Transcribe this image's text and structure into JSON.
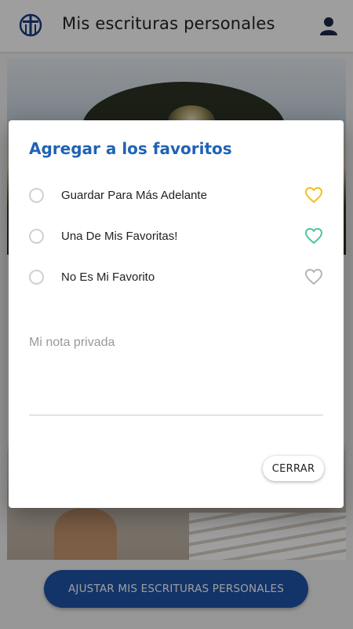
{
  "app_bar": {
    "title": "Mis escrituras personales",
    "logo_icon": "church-logo-icon",
    "profile_icon": "user-icon"
  },
  "main": {
    "adjust_button_label": "AJUSTAR MIS ESCRITURAS PERSONALES"
  },
  "dialog": {
    "title": "Agregar a los favoritos",
    "options": [
      {
        "label": "Guardar Para Más Adelante",
        "icon": "heart-outline-icon",
        "color": "#f2c01e"
      },
      {
        "label": "Una De Mis Favoritas!",
        "icon": "heart-outline-icon",
        "color": "#4fc3a1"
      },
      {
        "label": "No Es Mi Favorito",
        "icon": "heart-outline-icon",
        "color": "#b5b5b5"
      }
    ],
    "note_placeholder": "Mi nota privada",
    "close_label": "CERRAR"
  },
  "colors": {
    "accent": "#1f63b5",
    "button": "#1f55a8"
  }
}
